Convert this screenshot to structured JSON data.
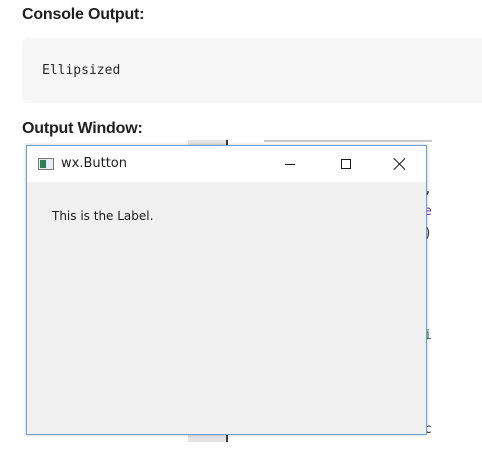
{
  "console": {
    "heading": "Console Output:",
    "output": "Ellipsized"
  },
  "output_window": {
    "heading": "Output Window:",
    "title": "wx.Button",
    "icon": "wx-app-icon",
    "label_text": "This is the Label."
  },
  "background_editor": {
    "fragments": [
      ",",
      "e",
      ")",
      "i",
      "c"
    ]
  },
  "colors": {
    "window_border": "#6d9fd0",
    "client_bg": "#f0f0f0",
    "console_bg": "#f6f6f6"
  }
}
